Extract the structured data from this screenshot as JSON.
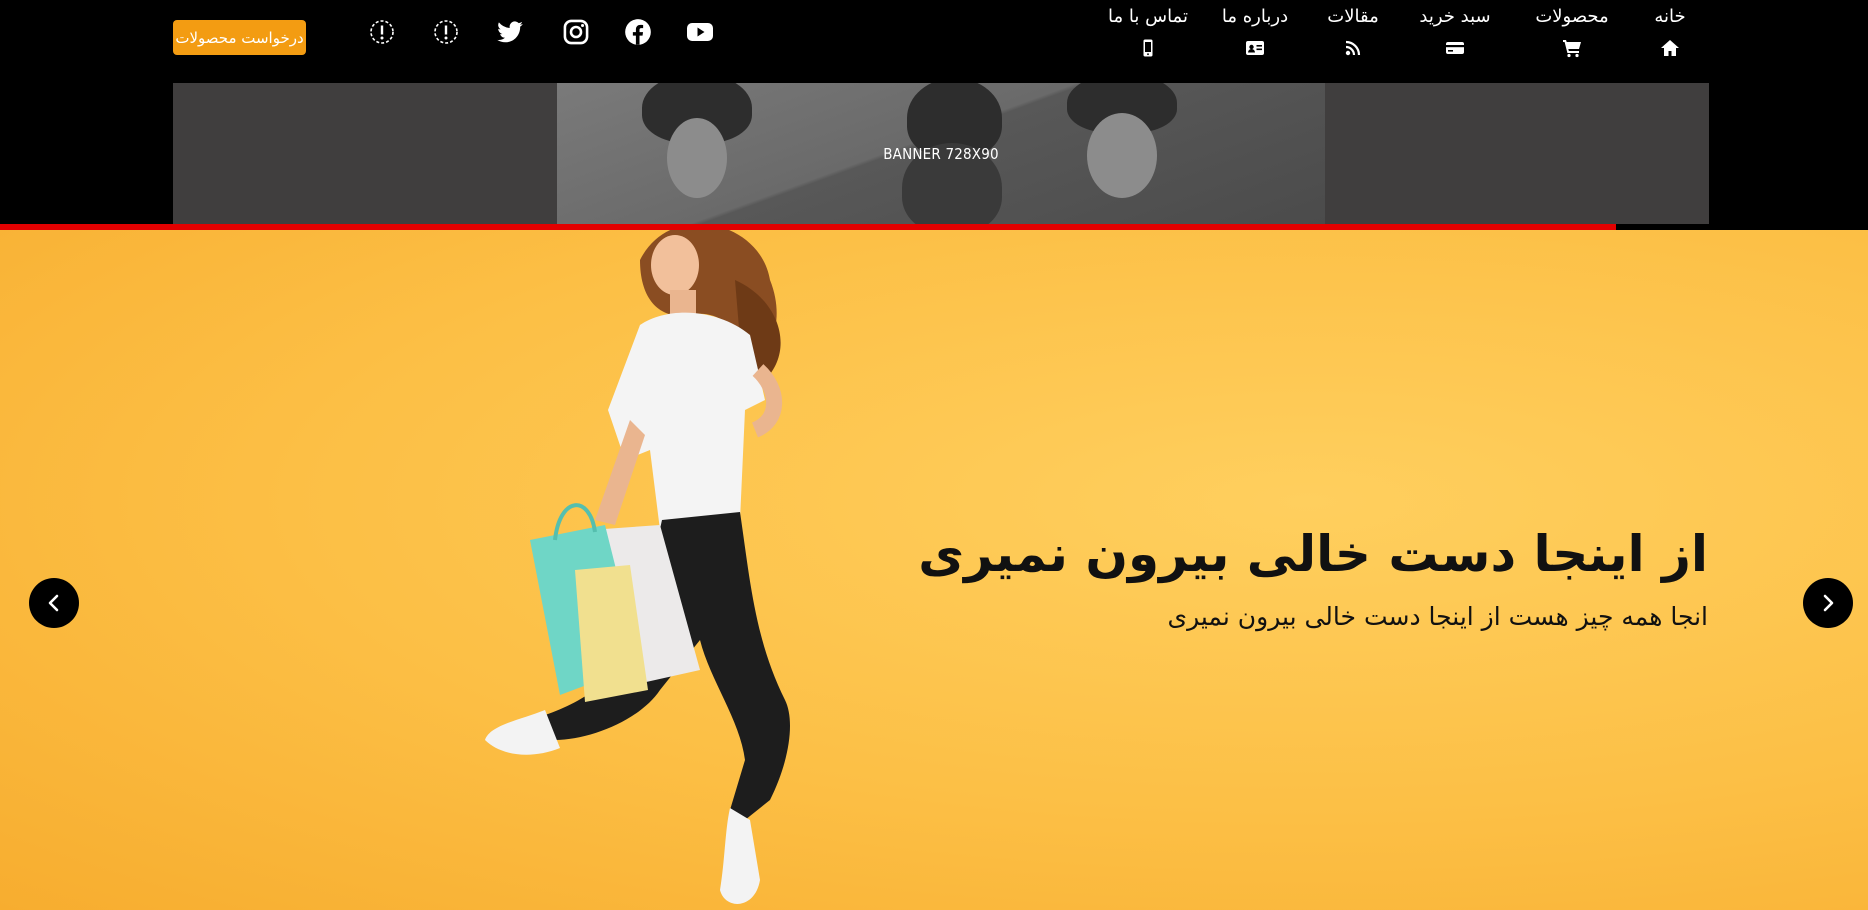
{
  "header": {
    "request_button": "درخواست محصولات",
    "social_icons": [
      "alert-icon",
      "alert-icon",
      "twitter-icon",
      "instagram-icon",
      "facebook-icon",
      "youtube-icon"
    ],
    "nav": [
      {
        "label": "خانه",
        "icon": "home-icon"
      },
      {
        "label": "محصولات",
        "icon": "cart-icon"
      },
      {
        "label": "سبد خرید",
        "icon": "credit-card-icon"
      },
      {
        "label": "مقالات",
        "icon": "feed-icon"
      },
      {
        "label": "درباره ما",
        "icon": "id-card-icon"
      },
      {
        "label": "تماس با ما",
        "icon": "mobile-icon"
      }
    ]
  },
  "banner": {
    "text": "BANNER 728X90"
  },
  "hero": {
    "title": "از اینجا دست خالی بیرون نمیری",
    "subtitle": "انجا همه چیز هست از اینجا دست خالی بیرون نمیری",
    "prev_icon": "chevron-left-icon",
    "next_icon": "chevron-right-icon"
  },
  "colors": {
    "header_bg": "#000000",
    "request_button": "#f39c12",
    "accent_line": "#e30000",
    "hero_bg": "#fcbf45"
  }
}
